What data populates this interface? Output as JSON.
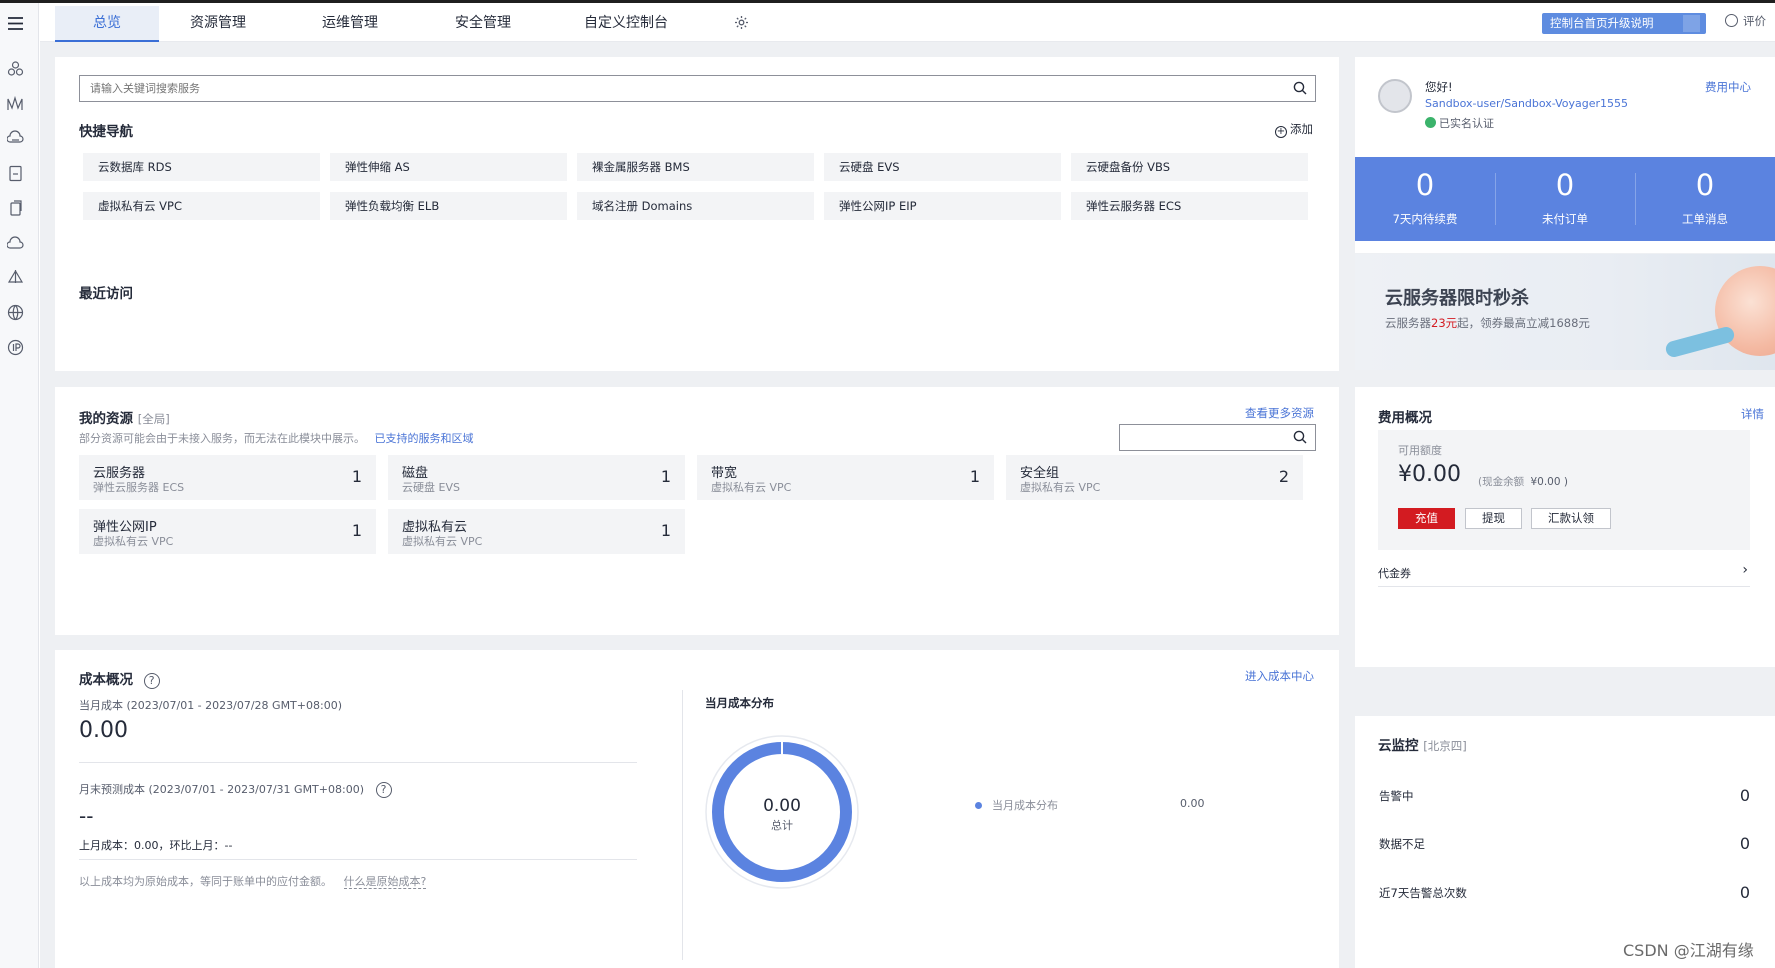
{
  "topbar": {
    "tabs": [
      {
        "label": "总览",
        "active": true
      },
      {
        "label": "资源管理",
        "active": false
      },
      {
        "label": "运维管理",
        "active": false
      },
      {
        "label": "安全管理",
        "active": false
      },
      {
        "label": "自定义控制台",
        "active": false
      }
    ],
    "upgrade_label": "控制台首页升级说明",
    "rate_label": "评价"
  },
  "search": {
    "placeholder": "请输入关键词搜索服务"
  },
  "quick_nav": {
    "title": "快捷导航",
    "add_label": "添加",
    "items": [
      "云数据库 RDS",
      "弹性伸缩 AS",
      "裸金属服务器 BMS",
      "云硬盘 EVS",
      "云硬盘备份 VBS",
      "虚拟私有云 VPC",
      "弹性负载均衡 ELB",
      "域名注册 Domains",
      "弹性公网IP EIP",
      "弹性云服务器 ECS"
    ]
  },
  "recent": {
    "title": "最近访问"
  },
  "user": {
    "greeting": "您好!",
    "username": "Sandbox-user/Sandbox-Voyager1555",
    "verified": "已实名认证",
    "fee_center": "费用中心"
  },
  "stats": [
    {
      "value": "0",
      "label": "7天内待续费"
    },
    {
      "value": "0",
      "label": "未付订单"
    },
    {
      "value": "0",
      "label": "工单消息"
    }
  ],
  "banner": {
    "title": "云服务器限时秒杀",
    "text_pre": "云服务器",
    "price": "23元",
    "text_post": "起，领券最高立减1688元"
  },
  "resources": {
    "title": "我的资源",
    "scope": "[全局]",
    "notice": "部分资源可能会由于未接入服务，而无法在此模块中展示。",
    "notice_link": "已支持的服务和区域",
    "more_link": "查看更多资源",
    "items": [
      {
        "name": "云服务器",
        "sub": "弹性云服务器 ECS",
        "count": "1"
      },
      {
        "name": "磁盘",
        "sub": "云硬盘 EVS",
        "count": "1"
      },
      {
        "name": "带宽",
        "sub": "虚拟私有云 VPC",
        "count": "1"
      },
      {
        "name": "安全组",
        "sub": "虚拟私有云 VPC",
        "count": "2"
      },
      {
        "name": "弹性公网IP",
        "sub": "虚拟私有云 VPC",
        "count": "1"
      },
      {
        "name": "虚拟私有云",
        "sub": "虚拟私有云 VPC",
        "count": "1"
      }
    ]
  },
  "fee": {
    "title": "费用概况",
    "detail_link": "详情",
    "quota_label": "可用额度",
    "amount": "¥0.00",
    "cash_label": "(现金余额",
    "cash_value": "¥0.00 )",
    "recharge": "充值",
    "withdraw": "提现",
    "remit": "汇款认领",
    "coupon": "代金券"
  },
  "cost": {
    "title": "成本概况",
    "center_link": "进入成本中心",
    "month_label": "当月成本 (2023/07/01 - 2023/07/28 GMT+08:00)",
    "month_value": "0.00",
    "forecast_label": "月末预测成本 (2023/07/01 - 2023/07/31 GMT+08:00)",
    "forecast_value": "--",
    "last_month": "上月成本：0.00，环比上月：--",
    "footnote": "以上成本均为原始成本，等同于账单中的应付金额。",
    "footnote_link": "什么是原始成本?",
    "dist_title": "当月成本分布",
    "donut_value": "0.00",
    "donut_label": "总计",
    "legend_label": "当月成本分布",
    "legend_value": "0.00",
    "accent": "#5b83e0"
  },
  "monitor": {
    "title": "云监控",
    "region": "[北京四]",
    "rows": [
      {
        "label": "告警中",
        "value": "0"
      },
      {
        "label": "数据不足",
        "value": "0"
      },
      {
        "label": "近7天告警总次数",
        "value": "0"
      }
    ]
  },
  "watermark": "CSDN @江湖有缘",
  "rail_icons": [
    "menu-icon",
    "cluster-icon",
    "chart-icon",
    "cloud-database-icon",
    "document-icon",
    "copy-icon",
    "cloud-icon",
    "sail-icon",
    "globe-icon",
    "ip-icon"
  ]
}
